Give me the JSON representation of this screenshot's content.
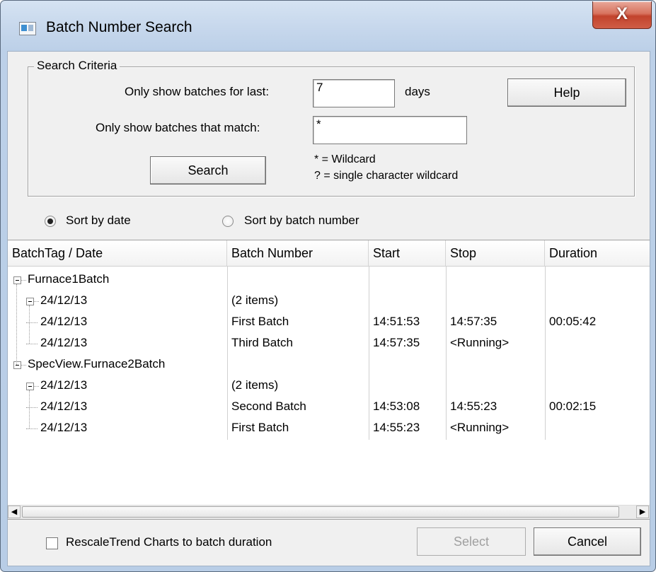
{
  "window": {
    "title": "Batch Number Search",
    "close_label": "X"
  },
  "search_criteria": {
    "legend": "Search Criteria",
    "days_label": "Only show batches for last:",
    "days_value": "7",
    "days_suffix": "days",
    "match_label": "Only show batches that match:",
    "match_value": "*",
    "search_button": "Search",
    "help_button": "Help",
    "wildcard_hint_1": "* = Wildcard",
    "wildcard_hint_2": "? = single character wildcard"
  },
  "sort": {
    "by_date_label": "Sort by date",
    "by_date_selected": true,
    "by_number_label": "Sort by batch number",
    "by_number_selected": false
  },
  "list": {
    "columns": [
      "BatchTag / Date",
      "Batch Number",
      "Start",
      "Stop",
      "Duration"
    ],
    "rows": [
      {
        "level": 0,
        "expander": true,
        "tag": "Furnace1Batch",
        "number": "",
        "start": "",
        "stop": "",
        "duration": ""
      },
      {
        "level": 1,
        "expander": true,
        "tag": "24/12/13",
        "number": "(2 items)",
        "start": "",
        "stop": "",
        "duration": ""
      },
      {
        "level": 2,
        "expander": false,
        "tag": "24/12/13",
        "number": "First Batch",
        "start": "14:51:53",
        "stop": "14:57:35",
        "duration": "00:05:42"
      },
      {
        "level": 2,
        "expander": false,
        "tag": "24/12/13",
        "number": "Third Batch",
        "start": "14:57:35",
        "stop": "<Running>",
        "duration": ""
      },
      {
        "level": 0,
        "expander": true,
        "tag": "SpecView.Furnace2Batch",
        "number": "",
        "start": "",
        "stop": "",
        "duration": ""
      },
      {
        "level": 1,
        "expander": true,
        "tag": "24/12/13",
        "number": "(2 items)",
        "start": "",
        "stop": "",
        "duration": ""
      },
      {
        "level": 2,
        "expander": false,
        "tag": "24/12/13",
        "number": "Second Batch",
        "start": "14:53:08",
        "stop": "14:55:23",
        "duration": "00:02:15"
      },
      {
        "level": 2,
        "expander": false,
        "tag": "24/12/13",
        "number": "First Batch",
        "start": "14:55:23",
        "stop": "<Running>",
        "duration": ""
      }
    ]
  },
  "footer": {
    "rescale_label": "RescaleTrend Charts to batch duration",
    "rescale_checked": false,
    "select_button": "Select",
    "cancel_button": "Cancel"
  }
}
